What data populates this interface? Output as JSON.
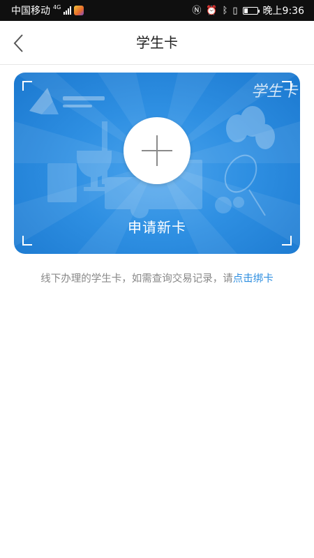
{
  "status_bar": {
    "carrier": "中国移动",
    "network": "4G",
    "time": "晚上9:36",
    "battery_level": 0.3
  },
  "nav": {
    "title": "学生卡"
  },
  "card": {
    "title": "申请新卡",
    "logo_text": "学生卡"
  },
  "hint": {
    "text": "线下办理的学生卡，如需查询交易记录，请",
    "link": "点击绑卡"
  },
  "colors": {
    "card_blue": "#2e8fe2",
    "link": "#2f8fe0",
    "hint_gray": "#888888"
  }
}
